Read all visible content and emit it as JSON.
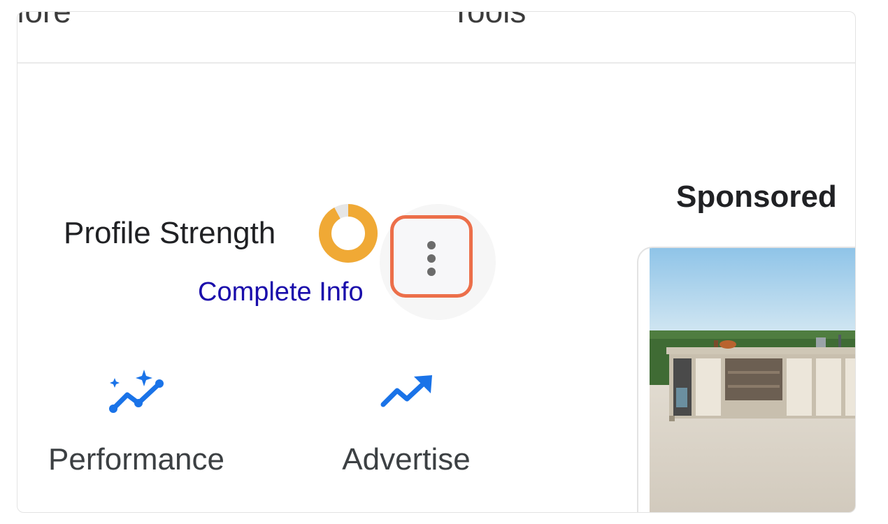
{
  "tabs": {
    "more_label": "More",
    "tools_label": "Tools"
  },
  "profile": {
    "strength_label": "Profile Strength",
    "strength_fraction": 0.92,
    "complete_link": "Complete Info",
    "menu_icon": "more-vert-icon"
  },
  "actions": [
    {
      "label": "Performance",
      "icon": "performance-sparkle-icon"
    },
    {
      "label": "Advertise",
      "icon": "trending-up-icon"
    }
  ],
  "sponsored": {
    "title": "Sponsored"
  },
  "colors": {
    "donut_fill": "#f0a935",
    "donut_track": "#e6e6e6",
    "link": "#1a0dab",
    "icon_blue": "#1a73e8",
    "highlight": "#ec6f4a"
  }
}
